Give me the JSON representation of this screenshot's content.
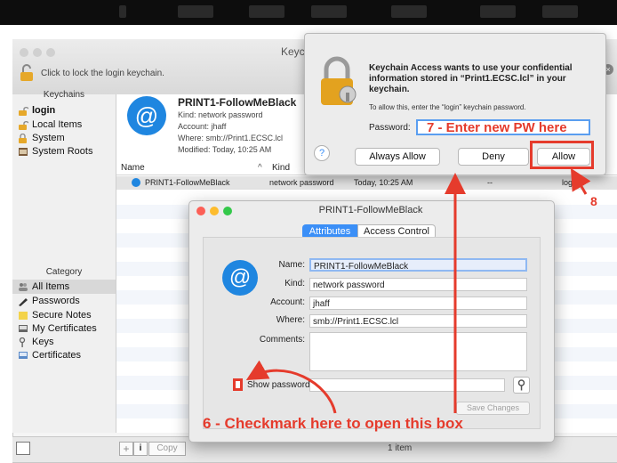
{
  "keychain": {
    "title_partial": "Keych",
    "lock_hint": "Click to lock the login keychain.",
    "keychains_header": "Keychains",
    "keychains": [
      "login",
      "Local Items",
      "System",
      "System Roots"
    ],
    "category_header": "Category",
    "categories": [
      "All Items",
      "Passwords",
      "Secure Notes",
      "My Certificates",
      "Keys",
      "Certificates"
    ],
    "selected_item": {
      "name": "PRINT1-FollowMeBlack",
      "kind": "Kind: network password",
      "account": "Account: jhaff",
      "where": "Where: smb://Print1.ECSC.lcl",
      "modified": "Modified: Today, 10:25 AM"
    },
    "columns": {
      "name": "Name",
      "kind": "Kind"
    },
    "row": {
      "name": "PRINT1-FollowMeBlack",
      "kind": "network password",
      "date": "Today, 10:25 AM",
      "expires": "--",
      "keychain": "login"
    },
    "bottom": {
      "copy": "Copy",
      "count": "1 item"
    }
  },
  "dialog": {
    "message": "Keychain Access wants to use your confidential information stored in “Print1.ECSC.lcl” in your keychain.",
    "hint": "To allow this, enter the “login” keychain password.",
    "password_label": "Password:",
    "always_allow": "Always Allow",
    "deny": "Deny",
    "allow": "Allow",
    "help": "?"
  },
  "detail": {
    "title": "PRINT1-FollowMeBlack",
    "tabs": [
      "Attributes",
      "Access Control"
    ],
    "labels": {
      "name": "Name:",
      "kind": "Kind:",
      "account": "Account:",
      "where": "Where:",
      "comments": "Comments:",
      "show_password": "Show password:"
    },
    "values": {
      "name": "PRINT1-FollowMeBlack",
      "kind": "network password",
      "account": "jhaff",
      "where": "smb://Print1.ECSC.lcl",
      "comments": ""
    },
    "save_changes": "Save Changes"
  },
  "annotations": {
    "step7": "7 - Enter new PW here",
    "step8": "8",
    "step6": "6 - Checkmark here to open this box"
  },
  "colors": {
    "annotation": "#e53b2c",
    "accent": "#3b8ff7"
  }
}
